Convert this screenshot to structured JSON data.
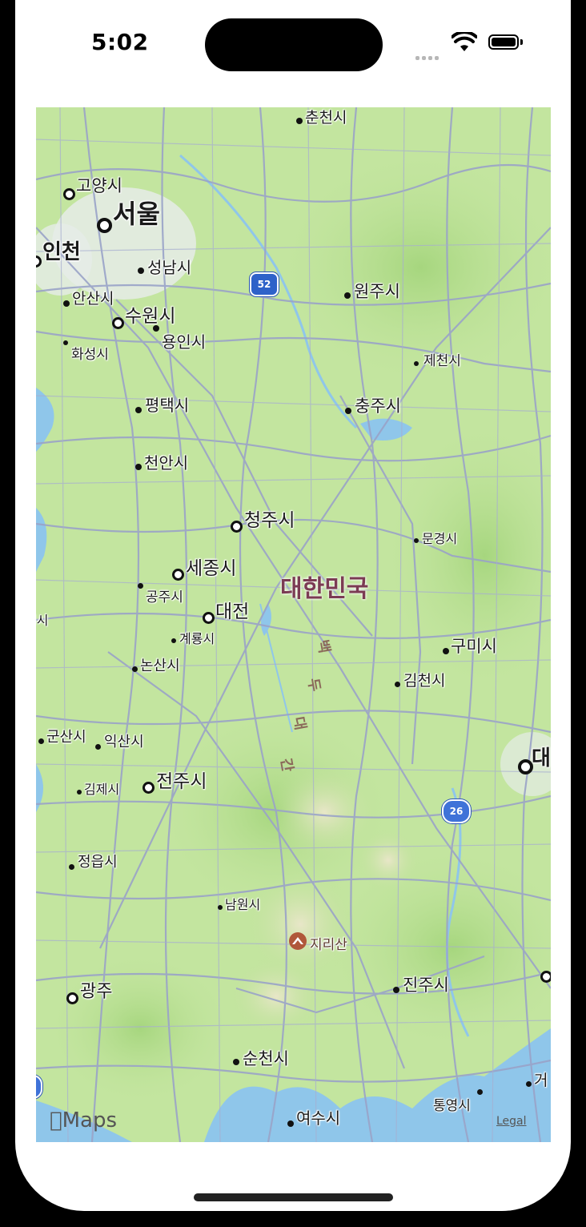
{
  "status_bar": {
    "time": "5:02",
    "icons": [
      "signal-icon",
      "wifi-icon",
      "battery-icon"
    ]
  },
  "map": {
    "country_label": "대한민국",
    "cities": [
      {
        "name": "춘천시"
      },
      {
        "name": "고양시"
      },
      {
        "name": "서울"
      },
      {
        "name": "인천"
      },
      {
        "name": "성남시"
      },
      {
        "name": "원주시"
      },
      {
        "name": "안산시"
      },
      {
        "name": "수원시"
      },
      {
        "name": "용인시"
      },
      {
        "name": "화성시"
      },
      {
        "name": "제천시"
      },
      {
        "name": "평택시"
      },
      {
        "name": "충주시"
      },
      {
        "name": "천안시"
      },
      {
        "name": "청주시"
      },
      {
        "name": "문경시"
      },
      {
        "name": "세종시"
      },
      {
        "name": "공주시"
      },
      {
        "name": "대전"
      },
      {
        "name": "계룡시"
      },
      {
        "name": "구미시"
      },
      {
        "name": "논산시"
      },
      {
        "name": "김천시"
      },
      {
        "name": "군산시"
      },
      {
        "name": "익산시"
      },
      {
        "name": "대"
      },
      {
        "name": "김제시"
      },
      {
        "name": "전주시"
      },
      {
        "name": "정읍시"
      },
      {
        "name": "남원시"
      },
      {
        "name": "광주"
      },
      {
        "name": "진주시"
      },
      {
        "name": "순천시"
      },
      {
        "name": "통영시"
      },
      {
        "name": "거"
      },
      {
        "name": "여수시"
      },
      {
        "name": "령시"
      }
    ],
    "poi": {
      "name": "지리산",
      "icon": "mountain-icon"
    },
    "highway_shields": [
      "52",
      "26"
    ],
    "trail_glyphs": [
      "백",
      "두",
      "대",
      "간"
    ],
    "brand": "Maps",
    "legal": "Legal"
  }
}
